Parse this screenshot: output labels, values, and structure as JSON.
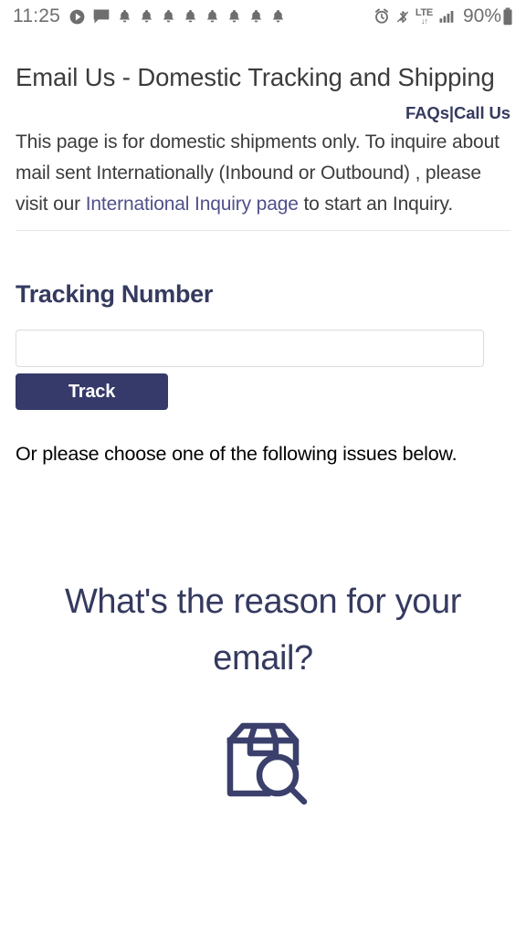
{
  "status_bar": {
    "time": "11:25",
    "left_icons": [
      "play-circle-icon",
      "chat-bubble-icon",
      "bell-icon",
      "bell-icon",
      "bell-icon",
      "bell-icon",
      "bell-icon",
      "bell-icon",
      "bell-icon",
      "bell-icon"
    ],
    "right_icons": [
      "alarm-clock-icon",
      "bluetooth-disabled-icon",
      "lte-icon",
      "signal-bars-icon"
    ],
    "network_type": "LTE",
    "battery_percent": "90%",
    "icon_color": "#6e6e6e"
  },
  "page": {
    "title": "Email Us - Domestic Tracking and Shipping",
    "header_links": {
      "faqs": "FAQs",
      "separator": "|",
      "call_us": "Call Us"
    },
    "intro": {
      "before_link": "This page is for domestic shipments only. To inquire about mail sent Internationally (Inbound or Outbound) , please visit our ",
      "link_text": "International Inquiry page",
      "after_link": " to start an Inquiry."
    },
    "tracking_section": {
      "heading": "Tracking Number",
      "input_value": "",
      "input_placeholder": "",
      "button_label": "Track"
    },
    "followup_text": "Or please choose one of the following issues below.",
    "reason_heading": "What's the reason for your email?",
    "reason_icon": "package-search-icon"
  },
  "colors": {
    "navy": "#353a5f",
    "button_navy": "#353a6a",
    "link_blue": "#50508a",
    "body_text": "#3c3c3c",
    "black_text": "#000000",
    "divider": "#e6e6ea",
    "input_border": "#dcdcdc"
  }
}
